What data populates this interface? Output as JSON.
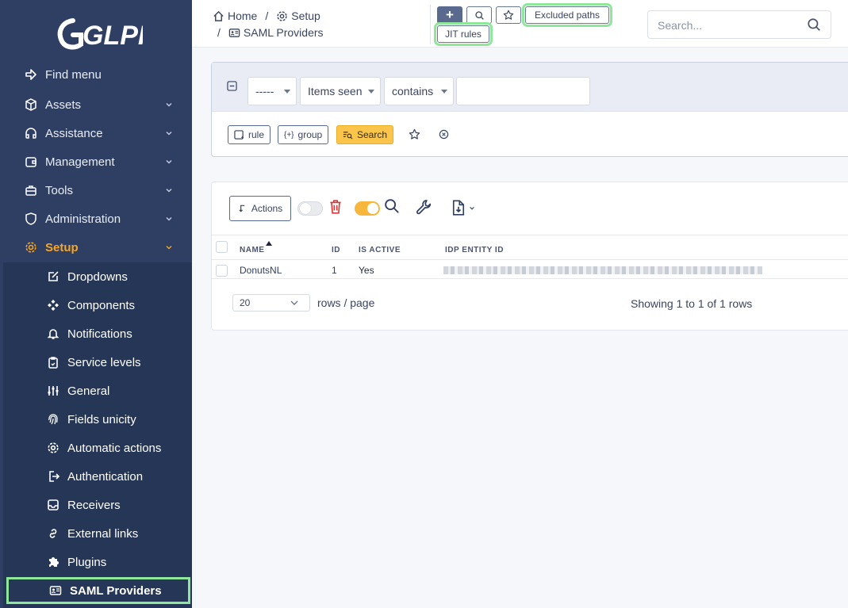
{
  "app": {
    "logo_text": "GLPI"
  },
  "sidebar": {
    "items": [
      {
        "label": "Find menu",
        "icon": "arrow-right-icon"
      },
      {
        "label": "Assets",
        "icon": "box-icon"
      },
      {
        "label": "Assistance",
        "icon": "headset-icon"
      },
      {
        "label": "Management",
        "icon": "wallet-icon"
      },
      {
        "label": "Tools",
        "icon": "briefcase-icon"
      },
      {
        "label": "Administration",
        "icon": "shield-icon"
      },
      {
        "label": "Setup",
        "icon": "gear-icon"
      }
    ],
    "setup_items": [
      {
        "label": "Dropdowns",
        "icon": "edit-icon"
      },
      {
        "label": "Components",
        "icon": "components-icon"
      },
      {
        "label": "Notifications",
        "icon": "bell-icon"
      },
      {
        "label": "Service levels",
        "icon": "clipboard-icon"
      },
      {
        "label": "General",
        "icon": "sliders-icon"
      },
      {
        "label": "Fields unicity",
        "icon": "fingerprint-icon"
      },
      {
        "label": "Automatic actions",
        "icon": "cog-icon"
      },
      {
        "label": "Authentication",
        "icon": "login-icon"
      },
      {
        "label": "Receivers",
        "icon": "inbox-icon"
      },
      {
        "label": "External links",
        "icon": "link-icon"
      },
      {
        "label": "Plugins",
        "icon": "puzzle-icon"
      },
      {
        "label": "SAML Providers",
        "icon": "id-card-icon"
      }
    ],
    "accent": "#f6a623"
  },
  "header": {
    "breadcrumb": {
      "home": "Home",
      "sep": "/",
      "setup": "Setup",
      "current": "SAML Providers"
    },
    "buttons": {
      "add": "+",
      "excluded_paths": "Excluded paths",
      "jit_rules": "JIT rules"
    },
    "search_placeholder": "Search..."
  },
  "criteria": {
    "field_1": "-----",
    "field_2": "Items seen",
    "operator": "contains",
    "value": "",
    "rule_label": "rule",
    "group_label": "group",
    "search_label": "Search"
  },
  "results": {
    "actions_label": "Actions",
    "columns": {
      "name": "NAME",
      "id": "ID",
      "is_active": "IS ACTIVE",
      "idp_entity_id": "IDP ENTITY ID"
    },
    "rows": [
      {
        "name": "DonutsNL",
        "id": "1",
        "is_active": "Yes"
      }
    ],
    "rows_per_page": "20",
    "rows_label": "rows / page",
    "showing": "Showing 1 to 1 of 1 rows"
  }
}
